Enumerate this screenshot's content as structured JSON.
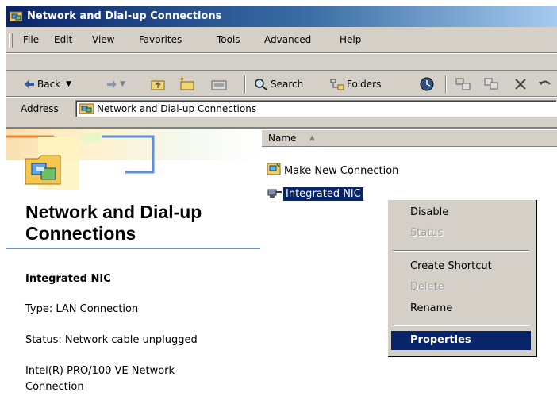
{
  "window": {
    "title": "Network and Dial-up Connections",
    "title_icon": "network-folder-icon"
  },
  "menubar": {
    "items": [
      "File",
      "Edit",
      "View",
      "Favorites",
      "Tools",
      "Advanced",
      "Help"
    ]
  },
  "toolbar": {
    "back": "Back",
    "search": "Search",
    "folders": "Folders",
    "icons": [
      "back-arrow-icon",
      "forward-arrow-icon",
      "up-folder-icon",
      "search-icon",
      "folders-icon",
      "history-icon",
      "move-to-icon",
      "copy-to-icon",
      "delete-icon"
    ]
  },
  "address": {
    "label": "Address",
    "value": "Network and Dial-up Connections"
  },
  "leftpane": {
    "title": "Network and Dial-up Connections",
    "selected_name": "Integrated NIC",
    "type": "Type: LAN Connection",
    "status": "Status: Network cable unplugged",
    "device_line1": "Intel(R) PRO/100 VE Network",
    "device_line2": "Connection"
  },
  "rightpane": {
    "column_header": "Name",
    "items": [
      {
        "label": "Make New Connection",
        "icon": "make-new-connection-icon"
      },
      {
        "label": "Integrated NIC",
        "icon": "lan-connection-icon",
        "selected": true
      }
    ]
  },
  "context_menu": {
    "items": [
      {
        "label": "Disable",
        "enabled": true
      },
      {
        "label": "Status",
        "enabled": false
      },
      {
        "label": "Create Shortcut",
        "enabled": true
      },
      {
        "label": "Delete",
        "enabled": false
      },
      {
        "label": "Rename",
        "enabled": true
      },
      {
        "label": "Properties",
        "enabled": true,
        "highlighted": true
      }
    ]
  },
  "colors": {
    "title_bar": "#0a246a",
    "selection": "#0a246a",
    "chrome": "#d4d0c8",
    "rule": "#6f8fc0"
  }
}
